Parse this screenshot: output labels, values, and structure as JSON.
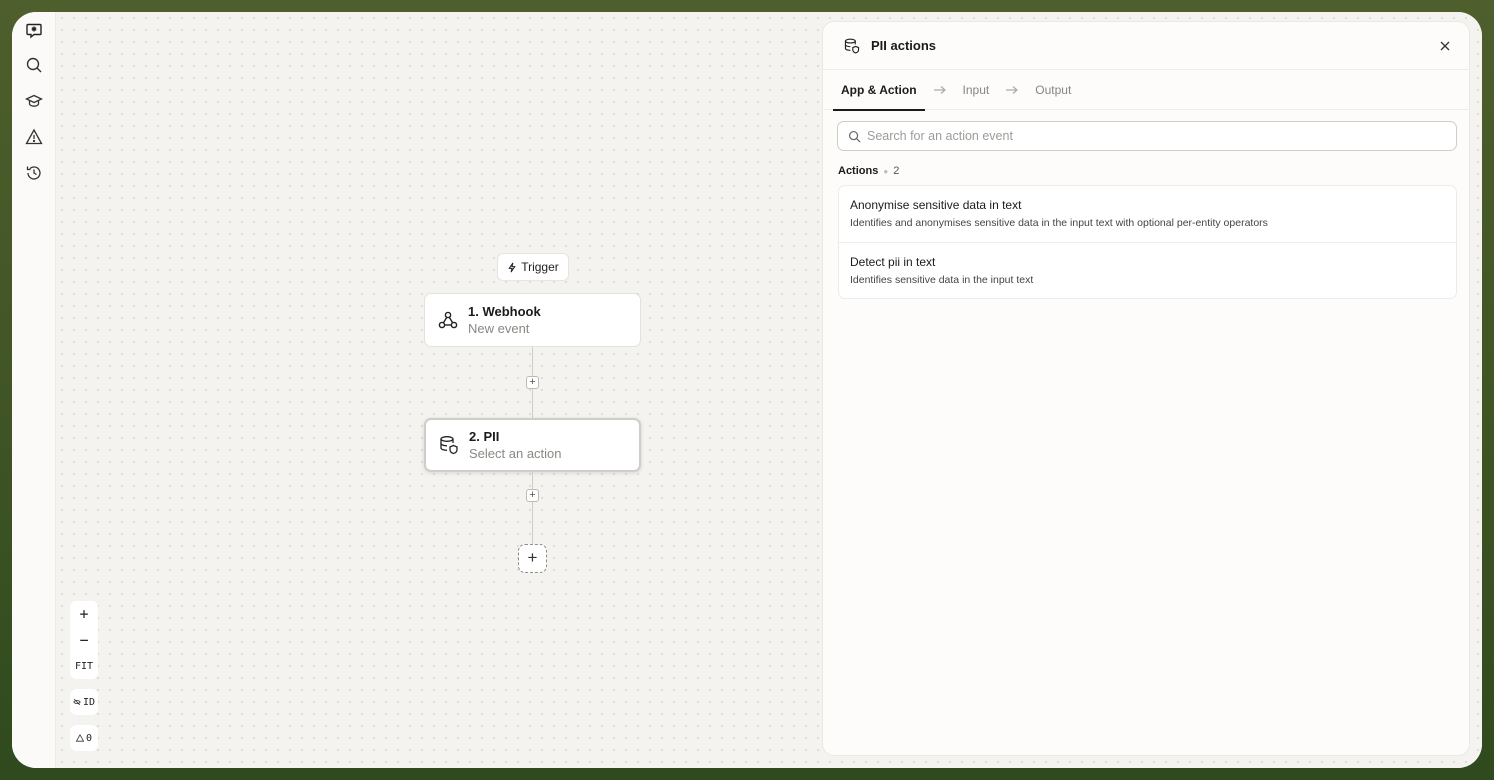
{
  "rail": {
    "items": [
      {
        "icon": "logo-asterisk-icon"
      },
      {
        "icon": "search-icon"
      },
      {
        "icon": "graduation-cap-icon"
      },
      {
        "icon": "warning-triangle-icon"
      },
      {
        "icon": "history-clock-icon"
      }
    ]
  },
  "canvas": {
    "trigger_label": "Trigger",
    "nodes": [
      {
        "title": "1. Webhook",
        "subtitle": "New event",
        "icon": "webhook-icon"
      },
      {
        "title": "2. PII",
        "subtitle": "Select an action",
        "icon": "database-shield-icon"
      }
    ],
    "add_step_label": "+",
    "zoom": {
      "zoom_in": "+",
      "zoom_out": "−",
      "fit": "FIT",
      "id_toggle": "ID",
      "warnings_count": "0"
    }
  },
  "panel": {
    "title": "PII actions",
    "tabs": [
      {
        "label": "App & Action",
        "active": true
      },
      {
        "label": "Input",
        "active": false
      },
      {
        "label": "Output",
        "active": false
      }
    ],
    "search": {
      "placeholder": "Search for an action event",
      "value": ""
    },
    "actions_label": "Actions",
    "actions_count": "2",
    "actions": [
      {
        "title": "Anonymise sensitive data in text",
        "description": "Identifies and anonymises sensitive data in the input text with optional per-entity operators"
      },
      {
        "title": "Detect pii in text",
        "description": "Identifies sensitive data in the input text"
      }
    ]
  },
  "colors": {
    "backdrop": "#3f5424",
    "canvas": "#f4f3f0",
    "panel": "#fdfcfa",
    "text": "#1b1b1b",
    "muted": "#8a8883"
  }
}
